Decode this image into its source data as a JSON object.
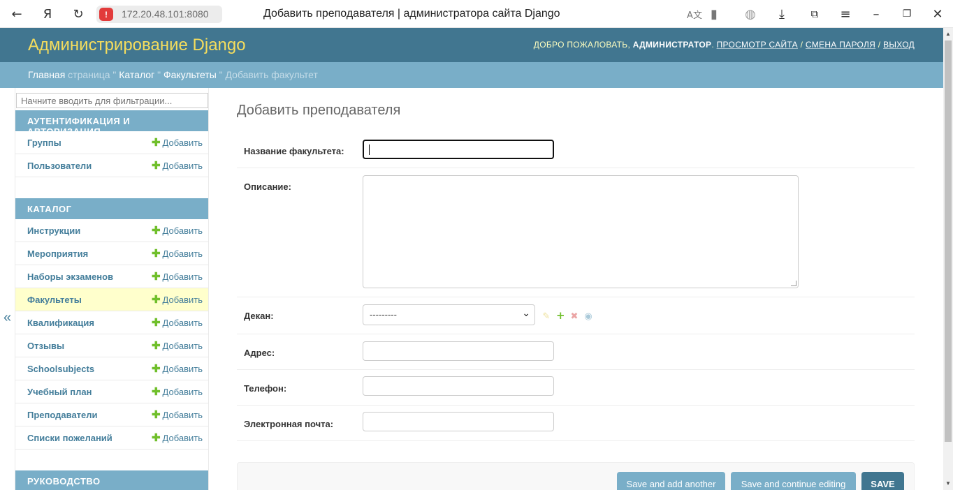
{
  "browser": {
    "url": "172.20.48.101:8080",
    "tab_title": "Добавить преподавателя | администратора сайта Django",
    "warning_glyph": "!"
  },
  "header": {
    "branding": "Администрирование Django",
    "welcome": "ДОБРО ПОЖАЛОВАТЬ, ",
    "username": "АДМИНИСТРАТОР",
    "after_user": ". ",
    "view_site": "ПРОСМОТР САЙТА",
    "slash1": " / ",
    "change_password": "СМЕНА ПАРОЛЯ",
    "slash2": " / ",
    "logout": "ВЫХОД"
  },
  "breadcrumbs": {
    "home_a": "Главная",
    "home_b": " страница",
    "sep": " \" ",
    "catalog": "Каталог",
    "faculties": "Факультеты",
    "current": "Добавить факультет"
  },
  "sidebar": {
    "filter_placeholder": "Начните вводить для фильтрации...",
    "add_label": "Добавить",
    "auth_caption": "Аутентификация и авторизация",
    "auth_items": [
      "Группы",
      "Пользователи"
    ],
    "catalog_caption": "Каталог",
    "catalog_items": [
      "Инструкции",
      "Мероприятия",
      "Наборы экзаменов",
      "Факультеты",
      "Квалификация",
      "Отзывы",
      "Schoolsubjects",
      "Учебный план",
      "Преподаватели",
      "Списки пожеланий"
    ],
    "current_item": "Факультеты",
    "guide_caption": "Руководство",
    "collapse_glyph": "«"
  },
  "form": {
    "title": "Добавить преподавателя",
    "faculty_name_label": "Название факультета:",
    "faculty_name_value": "",
    "description_label": "Описание:",
    "dean_label": "Декан:",
    "dean_selected": "---------",
    "address_label": "Адрес:",
    "phone_label": "Телефон:",
    "email_label": "Электронная почта:"
  },
  "buttons": {
    "save_add_another": "Save and add another",
    "save_continue": "Save and continue editing",
    "save": "SAVE"
  },
  "colors": {
    "header_bg": "#417690",
    "breadcrumbs_bg": "#79aec8",
    "branding": "#f5dd5d",
    "add_plus": "#70bf2b",
    "current_row": "#ffffcc"
  }
}
